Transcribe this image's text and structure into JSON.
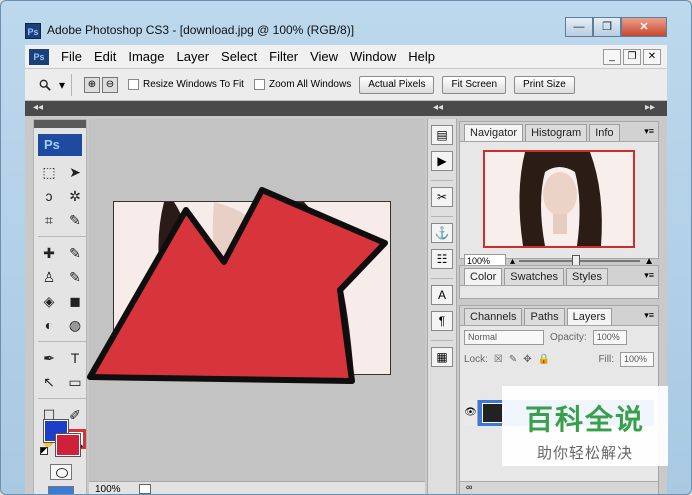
{
  "window": {
    "title": "Adobe Photoshop CS3 - [download.jpg @ 100% (RGB/8)]",
    "app_icon": "Ps",
    "minimize_glyph": "—",
    "maximize_glyph": "❐",
    "close_glyph": "✕"
  },
  "menubar": {
    "items": [
      "File",
      "Edit",
      "Image",
      "Layer",
      "Select",
      "Filter",
      "View",
      "Window",
      "Help"
    ],
    "doc_controls": [
      "_",
      "❐",
      "✕"
    ]
  },
  "options": {
    "zoom_in_glyph": "⊕",
    "zoom_out_glyph": "⊖",
    "resize_windows_label": "Resize Windows To Fit",
    "zoom_all_label": "Zoom All Windows",
    "actual_pixels_label": "Actual Pixels",
    "fit_screen_label": "Fit Screen",
    "print_size_label": "Print Size"
  },
  "tools": {
    "logo": "Ps",
    "rows": [
      [
        "⬚",
        "➤"
      ],
      [
        "ↄ",
        "✲"
      ],
      [
        "⌗",
        "✎"
      ],
      [
        "✚",
        "✎"
      ],
      [
        "♙",
        "✎"
      ],
      [
        "◈",
        "◼"
      ],
      [
        "◐",
        "◍"
      ],
      [
        "✒",
        "T"
      ],
      [
        "↖",
        "▭"
      ],
      [
        "☐",
        "✐"
      ],
      [
        "✋",
        "🔍"
      ]
    ],
    "foreground_color": "#1d3ec8",
    "background_color": "#d0213a"
  },
  "document": {
    "zoom": "100%"
  },
  "dock": {
    "icons": [
      "▤",
      "▶",
      "✂",
      "⚓",
      "☷",
      "A",
      "¶",
      "▦"
    ]
  },
  "navigator_panel": {
    "tabs": [
      "Navigator",
      "Histogram",
      "Info"
    ],
    "zoom": "100%"
  },
  "color_panel": {
    "tabs": [
      "Color",
      "Swatches",
      "Styles"
    ]
  },
  "layers_panel": {
    "tabs": [
      "Channels",
      "Paths",
      "Layers"
    ],
    "blend_mode": "Normal",
    "opacity_label": "Opacity:",
    "opacity_value": "100%",
    "lock_label": "Lock:",
    "fill_label": "Fill:",
    "fill_value": "100%"
  },
  "watermark": {
    "title": "百科全说",
    "subtitle": "助你轻松解决"
  },
  "colors": {
    "accent_red": "#d23438",
    "selection_blue": "#3d78d8"
  }
}
